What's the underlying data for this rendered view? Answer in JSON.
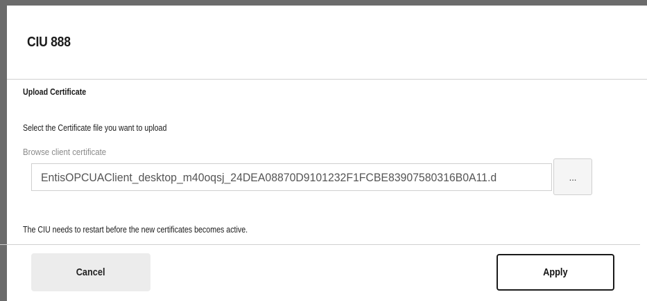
{
  "dialog": {
    "title": "CIU 888",
    "section_title": "Upload Certificate",
    "instruction": "Select the Certificate file you want to upload",
    "field_label": "Browse client certificate",
    "file_value": "EntisOPCUAClient_desktop_m40oqsj_24DEA08870D9101232F1FCBE83907580316B0A11.d",
    "browse_label": "...",
    "note": "The CIU needs to restart before the new certificates becomes active."
  },
  "footer": {
    "cancel_label": "Cancel",
    "apply_label": "Apply"
  }
}
